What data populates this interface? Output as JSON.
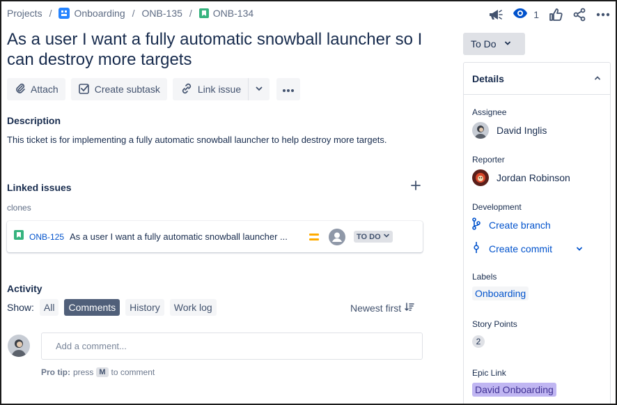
{
  "breadcrumb": {
    "projects": "Projects",
    "project": "Onboarding",
    "parent": "ONB-135",
    "current": "ONB-134",
    "separator": "/"
  },
  "top_actions": {
    "watch_count": "1",
    "icons": [
      "feedback-megaphone-icon",
      "eye-icon",
      "thumbs-up-icon",
      "share-icon",
      "more-icon"
    ]
  },
  "issue": {
    "title": "As a user I want a fully automatic snowball launcher so I can destroy more targets"
  },
  "toolbar": {
    "attach": "Attach",
    "create_subtask": "Create subtask",
    "link_issue": "Link issue"
  },
  "description": {
    "heading": "Description",
    "text": "This ticket is for implementing a fully automatic snowball launcher to help destroy more targets."
  },
  "linked_issues": {
    "heading": "Linked issues",
    "relation": "clones",
    "items": [
      {
        "key": "ONB-125",
        "summary": "As a user I want a fully automatic snowball launcher ...",
        "status": "TO DO",
        "priority": "medium"
      }
    ]
  },
  "activity": {
    "heading": "Activity",
    "show_label": "Show:",
    "filters": [
      "All",
      "Comments",
      "History",
      "Work log"
    ],
    "active_filter": "Comments",
    "sort": "Newest first",
    "comment_placeholder": "Add a comment...",
    "protip_label": "Pro tip:",
    "protip_press": "press",
    "protip_key": "M",
    "protip_rest": "to comment"
  },
  "status_button": "To Do",
  "details": {
    "heading": "Details",
    "assignee_label": "Assignee",
    "assignee": "David Inglis",
    "reporter_label": "Reporter",
    "reporter": "Jordan Robinson",
    "development_label": "Development",
    "create_branch": "Create branch",
    "create_commit": "Create commit",
    "labels_label": "Labels",
    "label_value": "Onboarding",
    "story_points_label": "Story Points",
    "story_points": "2",
    "epic_link_label": "Epic Link",
    "epic_link": "David Onboarding"
  },
  "colors": {
    "link_blue": "#0052cc",
    "project_icon_blue": "#2684ff",
    "story_green": "#36b37e",
    "priority_medium": "#ffab00",
    "epic_purple": "#c0b6f2",
    "active_filter_bg": "#505f79"
  }
}
